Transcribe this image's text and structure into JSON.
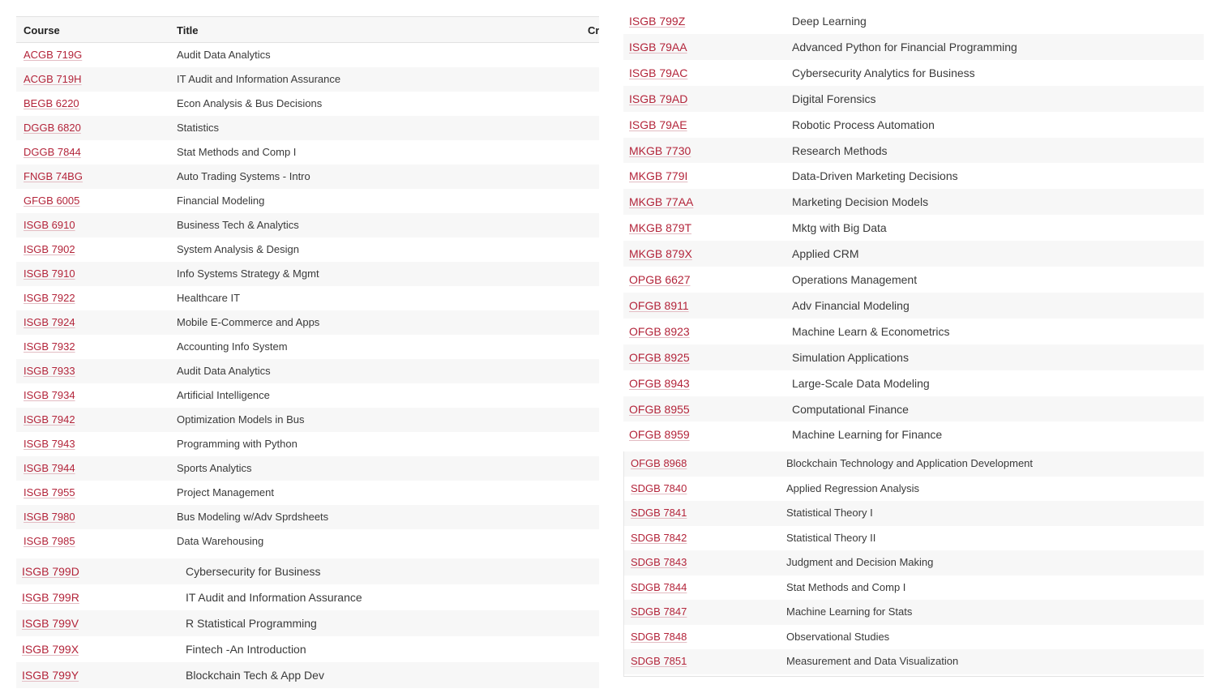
{
  "header": {
    "course": "Course",
    "title": "Title",
    "credits_partial": "Cr"
  },
  "left_top_rows": [
    {
      "code": "ACGB 719G",
      "title": "Audit Data Analytics"
    },
    {
      "code": "ACGB 719H",
      "title": "IT Audit and Information Assurance"
    },
    {
      "code": "BEGB 6220",
      "title": "Econ Analysis & Bus Decisions"
    },
    {
      "code": "DGGB 6820",
      "title": "Statistics"
    },
    {
      "code": "DGGB 7844",
      "title": "Stat Methods and Comp I"
    },
    {
      "code": "FNGB 74BG",
      "title": "Auto Trading Systems - Intro"
    },
    {
      "code": "GFGB 6005",
      "title": "Financial Modeling"
    },
    {
      "code": "ISGB 6910",
      "title": "Business Tech & Analytics"
    },
    {
      "code": "ISGB 7902",
      "title": "System Analysis & Design"
    },
    {
      "code": "ISGB 7910",
      "title": "Info Systems Strategy & Mgmt"
    },
    {
      "code": "ISGB 7922",
      "title": "Healthcare IT"
    },
    {
      "code": "ISGB 7924",
      "title": "Mobile E-Commerce and Apps"
    },
    {
      "code": "ISGB 7932",
      "title": "Accounting Info System"
    },
    {
      "code": "ISGB 7933",
      "title": "Audit Data Analytics"
    },
    {
      "code": "ISGB 7934",
      "title": "Artificial Intelligence"
    },
    {
      "code": "ISGB 7942",
      "title": "Optimization Models in Bus"
    },
    {
      "code": "ISGB 7943",
      "title": "Programming with Python"
    },
    {
      "code": "ISGB 7944",
      "title": "Sports Analytics"
    },
    {
      "code": "ISGB 7955",
      "title": "Project Management"
    },
    {
      "code": "ISGB 7980",
      "title": "Bus Modeling w/Adv Sprdsheets"
    },
    {
      "code": "ISGB 7985",
      "title": "Data Warehousing"
    }
  ],
  "left_bottom_rows": [
    {
      "code": "ISGB 799D",
      "title": "Cybersecurity for Business"
    },
    {
      "code": "ISGB 799R",
      "title": "IT Audit and Information Assurance"
    },
    {
      "code": "ISGB 799V",
      "title": "R Statistical Programming"
    },
    {
      "code": "ISGB 799X",
      "title": "Fintech -An Introduction"
    },
    {
      "code": "ISGB 799Y",
      "title": "Blockchain Tech & App Dev"
    }
  ],
  "right_top_rows": [
    {
      "code": "ISGB 799Z",
      "title": "Deep Learning"
    },
    {
      "code": "ISGB 79AA",
      "title": "Advanced Python for Financial Programming"
    },
    {
      "code": "ISGB 79AC",
      "title": "Cybersecurity Analytics for Business"
    },
    {
      "code": "ISGB 79AD",
      "title": "Digital Forensics"
    },
    {
      "code": "ISGB 79AE",
      "title": "Robotic Process Automation"
    },
    {
      "code": "MKGB 7730",
      "title": "Research Methods"
    },
    {
      "code": "MKGB 779I",
      "title": "Data-Driven Marketing Decisions"
    },
    {
      "code": "MKGB 77AA",
      "title": "Marketing Decision Models"
    },
    {
      "code": "MKGB 879T",
      "title": "Mktg with Big Data"
    },
    {
      "code": "MKGB 879X",
      "title": "Applied CRM"
    },
    {
      "code": "OPGB 6627",
      "title": "Operations Management"
    },
    {
      "code": "OFGB 8911",
      "title": "Adv Financial Modeling"
    },
    {
      "code": "OFGB 8923",
      "title": "Machine Learn & Econometrics"
    },
    {
      "code": "OFGB 8925",
      "title": "Simulation Applications"
    },
    {
      "code": "OFGB 8943",
      "title": "Large-Scale Data Modeling"
    },
    {
      "code": "OFGB 8955",
      "title": "Computational Finance"
    },
    {
      "code": "OFGB 8959",
      "title": "Machine Learning for Finance"
    }
  ],
  "right_bottom_rows": [
    {
      "code": "OFGB 8968",
      "title": "Blockchain Technology and Application Development"
    },
    {
      "code": "SDGB 7840",
      "title": "Applied Regression Analysis"
    },
    {
      "code": "SDGB 7841",
      "title": "Statistical Theory I"
    },
    {
      "code": "SDGB 7842",
      "title": "Statistical Theory II"
    },
    {
      "code": "SDGB 7843",
      "title": "Judgment and Decision Making"
    },
    {
      "code": "SDGB 7844",
      "title": "Stat Methods and Comp I"
    },
    {
      "code": "SDGB 7847",
      "title": "Machine Learning for Stats"
    },
    {
      "code": "SDGB 7848",
      "title": "Observational Studies"
    },
    {
      "code": "SDGB 7851",
      "title": "Measurement and Data Visualization"
    }
  ],
  "colors": {
    "link": "#b3243a",
    "stripe": "#f7f7f7",
    "text": "#3a3a3a"
  }
}
